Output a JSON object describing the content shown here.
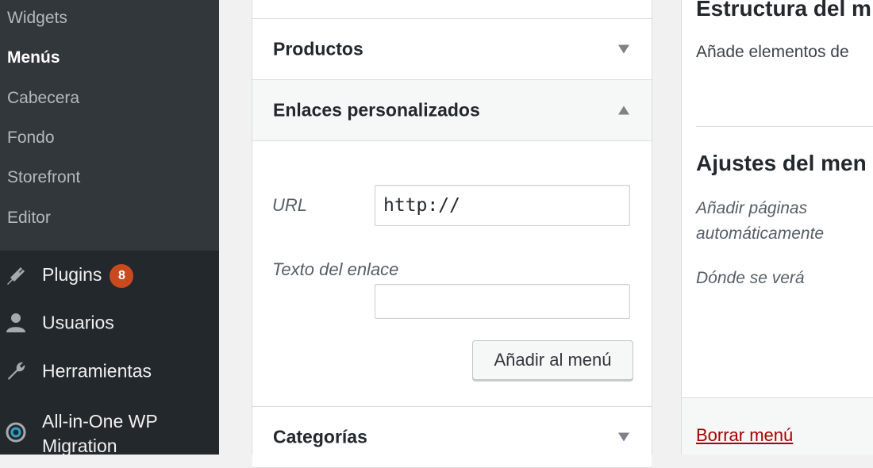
{
  "sidebar": {
    "submenu": [
      "Widgets",
      "Menús",
      "Cabecera",
      "Fondo",
      "Storefront",
      "Editor"
    ],
    "items": [
      {
        "label": "Plugins",
        "icon": "plugin-icon",
        "badge": "8"
      },
      {
        "label": "Usuarios",
        "icon": "user-icon"
      },
      {
        "label": "Herramientas",
        "icon": "wrench-icon"
      },
      {
        "label": "All-in-One WP Migration",
        "icon": "migration-icon"
      }
    ]
  },
  "panel": {
    "sections": [
      {
        "title": "Productos",
        "state": "collapsed"
      },
      {
        "title": "Enlaces personalizados",
        "state": "expanded"
      },
      {
        "title": "Categorías",
        "state": "collapsed"
      }
    ],
    "custom_links": {
      "url_label": "URL",
      "url_value": "http://",
      "link_text_label": "Texto del enlace",
      "link_text_value": "",
      "add_button": "Añadir al menú"
    }
  },
  "right": {
    "structure_title": "Estructura del m",
    "structure_desc": "Añade elementos de",
    "settings_title": "Ajustes del men",
    "auto_add_label": "Añadir páginas automáticamente",
    "display_label": "Dónde se verá",
    "delete_link": "Borrar menú"
  },
  "colors": {
    "sidebar_bg": "#23282d",
    "submenu_bg": "#32373c",
    "badge_bg": "#ca4a1f",
    "delete_link": "#aa0000"
  }
}
